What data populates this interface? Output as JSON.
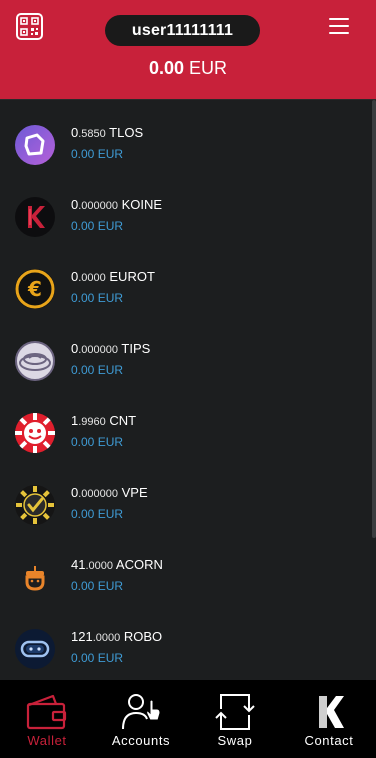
{
  "header": {
    "username": "user11111111",
    "balance_amount": "0.00",
    "balance_currency": "EUR",
    "brand_color": "#c8213a"
  },
  "tokens": [
    {
      "int": "0",
      "dec": ".5850",
      "symbol": "TLOS",
      "fiat": "0.00 EUR",
      "icon": "tlos-icon"
    },
    {
      "int": "0",
      "dec": ".000000",
      "symbol": "KOINE",
      "fiat": "0.00 EUR",
      "icon": "koine-icon"
    },
    {
      "int": "0",
      "dec": ".0000",
      "symbol": "EUROT",
      "fiat": "0.00 EUR",
      "icon": "eurot-icon"
    },
    {
      "int": "0",
      "dec": ".000000",
      "symbol": "TIPS",
      "fiat": "0.00 EUR",
      "icon": "tips-icon"
    },
    {
      "int": "1",
      "dec": ".9960",
      "symbol": "CNT",
      "fiat": "0.00 EUR",
      "icon": "cnt-icon"
    },
    {
      "int": "0",
      "dec": ".000000",
      "symbol": "VPE",
      "fiat": "0.00 EUR",
      "icon": "vpe-icon"
    },
    {
      "int": "41",
      "dec": ".0000",
      "symbol": "ACORN",
      "fiat": "0.00 EUR",
      "icon": "acorn-icon"
    },
    {
      "int": "121",
      "dec": ".0000",
      "symbol": "ROBO",
      "fiat": "0.00 EUR",
      "icon": "robo-icon"
    }
  ],
  "nav": {
    "wallet": "Wallet",
    "accounts": "Accounts",
    "swap": "Swap",
    "contact": "Contact"
  }
}
